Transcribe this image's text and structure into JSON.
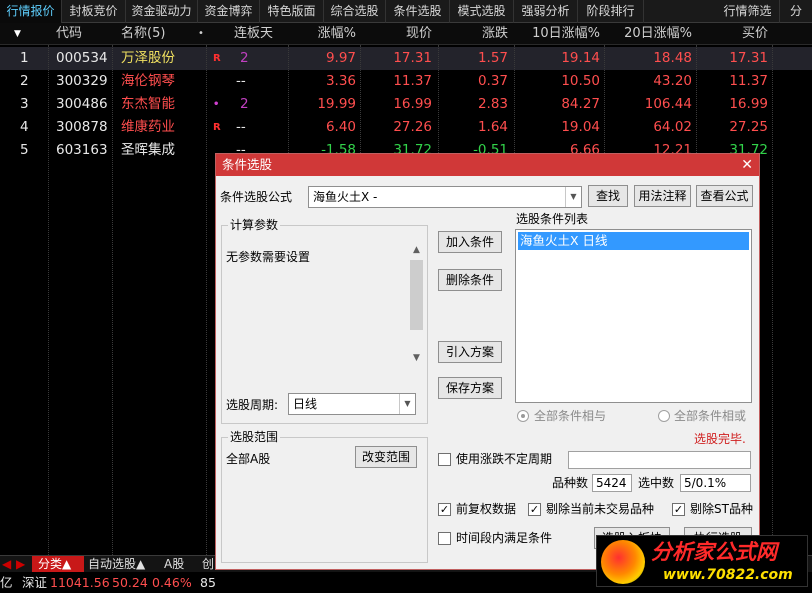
{
  "top_tabs": [
    "行情报价",
    "封板竞价",
    "资金驱动力",
    "资金博弈",
    "特色版面",
    "综合选股",
    "条件选股",
    "模式选股",
    "强弱分析",
    "阶段排行",
    "行情筛选",
    "分"
  ],
  "table": {
    "headers": [
      "代码",
      "名称(5)",
      "•",
      "连板天",
      "涨幅%",
      "现价",
      "涨跌",
      "10日涨幅%",
      "20日涨幅%",
      "买价"
    ],
    "sort_icon": "down-triangle-icon",
    "rows": [
      {
        "idx": "1",
        "code": "000534",
        "name": "万泽股份",
        "marker": "R",
        "days": "2",
        "pct": "9.97",
        "price": "17.31",
        "chg": "1.57",
        "pct10": "19.14",
        "pct20": "18.48",
        "bid": "17.31"
      },
      {
        "idx": "2",
        "code": "300329",
        "name": "海伦钢琴",
        "marker": "",
        "days": "--",
        "pct": "3.36",
        "price": "11.37",
        "chg": "0.37",
        "pct10": "10.50",
        "pct20": "43.20",
        "bid": "11.37"
      },
      {
        "idx": "3",
        "code": "300486",
        "name": "东杰智能",
        "marker": "•",
        "days": "2",
        "pct": "19.99",
        "price": "16.99",
        "chg": "2.83",
        "pct10": "84.27",
        "pct20": "106.44",
        "bid": "16.99"
      },
      {
        "idx": "4",
        "code": "300878",
        "name": "维康药业",
        "marker": "R",
        "days": "--",
        "pct": "6.40",
        "price": "27.26",
        "chg": "1.64",
        "pct10": "19.04",
        "pct20": "64.02",
        "bid": "27.25"
      },
      {
        "idx": "5",
        "code": "603163",
        "name": "圣晖集成",
        "marker": "",
        "days": "--",
        "pct": "-1.58",
        "price": "31.72",
        "chg": "-0.51",
        "pct10": "6.66",
        "pct20": "12.21",
        "bid": "31.72"
      }
    ]
  },
  "bottom_tabs": [
    "◀",
    "▶",
    "分类▲",
    "自动选股▲",
    "A股",
    "创"
  ],
  "status": {
    "prefix": "亿",
    "index_name": "深证",
    "index_value": "11041.56",
    "index_chg": "50.24",
    "index_pct": "0.46%",
    "extra": "85"
  },
  "dialog": {
    "title": "条件选股",
    "close": "✕",
    "formula_label": "条件选股公式",
    "formula_value": "海鱼火土X  -",
    "btn_find": "查找",
    "btn_usage": "用法注释",
    "btn_view": "查看公式",
    "params_label": "计算参数",
    "params_text": "无参数需要设置",
    "period_label": "选股周期:",
    "period_value": "日线",
    "btn_add": "加入条件",
    "btn_delete": "删除条件",
    "btn_import": "引入方案",
    "btn_save": "保存方案",
    "list_label": "选股条件列表",
    "list_items": [
      "海鱼火土X  日线"
    ],
    "radio_and": "全部条件相与",
    "radio_or": "全部条件相或",
    "done_text": "选股完毕.",
    "range_label": "选股范围",
    "range_value": "全部A股",
    "btn_change_range": "改变范围",
    "chk_variable": "使用涨跌不定周期",
    "count_label": "品种数",
    "count_value": "5424",
    "selected_label": "选中数",
    "selected_value": "5/0.1%",
    "chk_adjust": "前复权数据",
    "chk_remove_untraded": "剔除当前未交易品种",
    "chk_remove_st": "剔除ST品种",
    "chk_period": "时间段内满足条件",
    "btn_to_board": "选股入板块",
    "btn_execute": "执行选股"
  },
  "watermark": {
    "title": "分析家公式网",
    "url": "www.70822.com"
  },
  "colors": {
    "up": "#ff4e4e",
    "down": "#32d34a",
    "title_red": "#d03838",
    "select_blue": "#3399ff",
    "tab_active": "#5fd0ff"
  }
}
